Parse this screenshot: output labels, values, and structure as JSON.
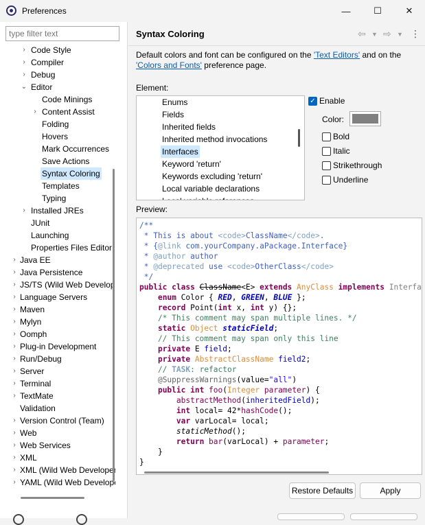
{
  "window": {
    "title": "Preferences",
    "minimize": "—",
    "maximize": "☐",
    "close": "✕"
  },
  "filter": {
    "placeholder": "type filter text"
  },
  "tree": [
    {
      "label": "Code Style",
      "twisty": "›",
      "indent": 1
    },
    {
      "label": "Compiler",
      "twisty": "›",
      "indent": 1
    },
    {
      "label": "Debug",
      "twisty": "›",
      "indent": 1
    },
    {
      "label": "Editor",
      "twisty": "⌄",
      "indent": 1
    },
    {
      "label": "Code Minings",
      "twisty": "",
      "indent": 2
    },
    {
      "label": "Content Assist",
      "twisty": "›",
      "indent": 2
    },
    {
      "label": "Folding",
      "twisty": "",
      "indent": 2
    },
    {
      "label": "Hovers",
      "twisty": "",
      "indent": 2
    },
    {
      "label": "Mark Occurrences",
      "twisty": "",
      "indent": 2
    },
    {
      "label": "Save Actions",
      "twisty": "",
      "indent": 2
    },
    {
      "label": "Syntax Coloring",
      "twisty": "",
      "indent": 2,
      "selected": true
    },
    {
      "label": "Templates",
      "twisty": "",
      "indent": 2
    },
    {
      "label": "Typing",
      "twisty": "",
      "indent": 2
    },
    {
      "label": "Installed JREs",
      "twisty": "›",
      "indent": 1
    },
    {
      "label": "JUnit",
      "twisty": "",
      "indent": 1
    },
    {
      "label": "Launching",
      "twisty": "",
      "indent": 1
    },
    {
      "label": "Properties Files Editor",
      "twisty": "",
      "indent": 1
    },
    {
      "label": "Java EE",
      "twisty": "›",
      "indent": 0
    },
    {
      "label": "Java Persistence",
      "twisty": "›",
      "indent": 0
    },
    {
      "label": "JS/TS (Wild Web Developer)",
      "twisty": "›",
      "indent": 0
    },
    {
      "label": "Language Servers",
      "twisty": "›",
      "indent": 0
    },
    {
      "label": "Maven",
      "twisty": "›",
      "indent": 0
    },
    {
      "label": "Mylyn",
      "twisty": "›",
      "indent": 0
    },
    {
      "label": "Oomph",
      "twisty": "›",
      "indent": 0
    },
    {
      "label": "Plug-in Development",
      "twisty": "›",
      "indent": 0
    },
    {
      "label": "Run/Debug",
      "twisty": "›",
      "indent": 0
    },
    {
      "label": "Server",
      "twisty": "›",
      "indent": 0
    },
    {
      "label": "Terminal",
      "twisty": "›",
      "indent": 0
    },
    {
      "label": "TextMate",
      "twisty": "›",
      "indent": 0
    },
    {
      "label": "Validation",
      "twisty": "",
      "indent": 0
    },
    {
      "label": "Version Control (Team)",
      "twisty": "›",
      "indent": 0
    },
    {
      "label": "Web",
      "twisty": "›",
      "indent": 0
    },
    {
      "label": "Web Services",
      "twisty": "›",
      "indent": 0
    },
    {
      "label": "XML",
      "twisty": "›",
      "indent": 0
    },
    {
      "label": "XML (Wild Web Developer)",
      "twisty": "›",
      "indent": 0
    },
    {
      "label": "YAML (Wild Web Developer)",
      "twisty": "›",
      "indent": 0
    }
  ],
  "page": {
    "title": "Syntax Coloring",
    "desc_before": "Default colors and font can be configured on the ",
    "link_text_editors": "'Text Editors'",
    "desc_middle": " and on the ",
    "link_colors_fonts": "'Colors and Fonts'",
    "desc_after": " preference page.",
    "element_label": "Element:",
    "preview_label": "Preview:"
  },
  "elements": [
    {
      "label": "Enums"
    },
    {
      "label": "Fields"
    },
    {
      "label": "Inherited fields"
    },
    {
      "label": "Inherited method invocations"
    },
    {
      "label": "Interfaces",
      "selected": true
    },
    {
      "label": "Keyword 'return'"
    },
    {
      "label": "Keywords excluding 'return'"
    },
    {
      "label": "Local variable declarations"
    },
    {
      "label": "Local variable references"
    }
  ],
  "options": {
    "enable": {
      "label": "Enable",
      "checked": true
    },
    "color_label": "Color:",
    "color_value": "#808080",
    "bold": {
      "label": "Bold",
      "checked": false
    },
    "italic": {
      "label": "Italic",
      "checked": false
    },
    "strikethrough": {
      "label": "Strikethrough",
      "checked": false
    },
    "underline": {
      "label": "Underline",
      "checked": false
    }
  },
  "colors": {
    "javadoc": "#3f5fbf",
    "tag": "#7f9fbf",
    "keyword": "#7f0055",
    "comment": "#3f7f5f",
    "interface": "#808080",
    "constant": "#0000c0",
    "field": "#0000c0",
    "string": "#2a00ff",
    "method": "#7f0055",
    "class": "#dc8c3c",
    "annotation": "#646464",
    "plain": "#000000",
    "task": "#7f9fbf",
    "selection": "#cde8ff",
    "link": "#0b5cad"
  },
  "code": [
    [
      [
        "/**",
        "javadoc"
      ]
    ],
    [
      [
        " * This is about ",
        "javadoc"
      ],
      [
        "<code>",
        "tag"
      ],
      [
        "ClassName",
        "javadoc"
      ],
      [
        "</code>",
        "tag"
      ],
      [
        ".",
        "javadoc"
      ]
    ],
    [
      [
        " * {",
        "javadoc"
      ],
      [
        "@link",
        "tag"
      ],
      [
        " com.yourCompany.aPackage.Interface}",
        "javadoc"
      ]
    ],
    [
      [
        " * ",
        "javadoc"
      ],
      [
        "@author",
        "tag"
      ],
      [
        " author",
        "javadoc"
      ]
    ],
    [
      [
        " * ",
        "javadoc"
      ],
      [
        "@deprecated",
        "tag"
      ],
      [
        " use ",
        "javadoc"
      ],
      [
        "<code>",
        "tag"
      ],
      [
        "OtherClass",
        "javadoc"
      ],
      [
        "</code>",
        "tag"
      ]
    ],
    [
      [
        " */",
        "javadoc"
      ]
    ],
    [
      [
        "public class ",
        "keyword"
      ],
      [
        "ClassName",
        "plain-strike"
      ],
      [
        "<E> ",
        "plain"
      ],
      [
        "extends ",
        "keyword"
      ],
      [
        "AnyClass ",
        "class"
      ],
      [
        "implements ",
        "keyword"
      ],
      [
        "InterfaceName",
        "interface"
      ]
    ],
    [
      [
        "    ",
        "plain"
      ],
      [
        "enum ",
        "keyword"
      ],
      [
        "Color { ",
        "plain"
      ],
      [
        "RED",
        "constant"
      ],
      [
        ", ",
        "plain"
      ],
      [
        "GREEN",
        "constant"
      ],
      [
        ", ",
        "plain"
      ],
      [
        "BLUE",
        "constant"
      ],
      [
        " };",
        "plain"
      ]
    ],
    [
      [
        "    ",
        "plain"
      ],
      [
        "record ",
        "keyword"
      ],
      [
        "Point(",
        "plain"
      ],
      [
        "int ",
        "keyword"
      ],
      [
        "x, ",
        "plain"
      ],
      [
        "int ",
        "keyword"
      ],
      [
        "y) {};",
        "plain"
      ]
    ],
    [
      [
        "    /* This comment may span multiple lines. */",
        "comment"
      ]
    ],
    [
      [
        "    ",
        "plain"
      ],
      [
        "static ",
        "keyword"
      ],
      [
        "Object ",
        "class"
      ],
      [
        "staticField",
        "field-italic"
      ],
      [
        ";",
        "plain"
      ]
    ],
    [
      [
        "    // This comment may span only this line",
        "comment"
      ]
    ],
    [
      [
        "    ",
        "plain"
      ],
      [
        "private ",
        "keyword"
      ],
      [
        "E ",
        "plain"
      ],
      [
        "field",
        "field"
      ],
      [
        ";",
        "plain"
      ]
    ],
    [
      [
        "    ",
        "plain"
      ],
      [
        "private ",
        "keyword"
      ],
      [
        "AbstractClassName ",
        "class"
      ],
      [
        "field2",
        "field"
      ],
      [
        ";",
        "plain"
      ]
    ],
    [
      [
        "    // ",
        "comment"
      ],
      [
        "TASK",
        "task-bold"
      ],
      [
        ": refactor",
        "comment"
      ]
    ],
    [
      [
        "    ",
        "plain"
      ],
      [
        "@SuppressWarnings",
        "annotation"
      ],
      [
        "(value=",
        "plain"
      ],
      [
        "\"all\"",
        "string"
      ],
      [
        ")",
        "plain"
      ]
    ],
    [
      [
        "    ",
        "plain"
      ],
      [
        "public int ",
        "keyword"
      ],
      [
        "foo",
        "method-plain"
      ],
      [
        "(",
        "plain"
      ],
      [
        "Integer ",
        "class"
      ],
      [
        "parameter",
        "method-plain"
      ],
      [
        ") {",
        "plain"
      ]
    ],
    [
      [
        "        ",
        "plain"
      ],
      [
        "abstractMethod",
        "method-plain"
      ],
      [
        "(",
        "plain"
      ],
      [
        "inheritedField",
        "field"
      ],
      [
        ");",
        "plain"
      ]
    ],
    [
      [
        "        ",
        "plain"
      ],
      [
        "int ",
        "keyword"
      ],
      [
        "local",
        "plain"
      ],
      [
        "= 42*",
        "plain"
      ],
      [
        "hashCode",
        "method-plain"
      ],
      [
        "();",
        "plain"
      ]
    ],
    [
      [
        "        ",
        "plain"
      ],
      [
        "var ",
        "keyword"
      ],
      [
        "varLocal",
        "plain"
      ],
      [
        "= local;",
        "plain"
      ]
    ],
    [
      [
        "        ",
        "plain"
      ],
      [
        "staticMethod",
        "italic"
      ],
      [
        "();",
        "plain"
      ]
    ],
    [
      [
        "        ",
        "plain"
      ],
      [
        "return ",
        "keyword"
      ],
      [
        "bar",
        "method-plain"
      ],
      [
        "(varLocal) + ",
        "plain"
      ],
      [
        "parameter",
        "method-plain"
      ],
      [
        ";",
        "plain"
      ]
    ],
    [
      [
        "    }",
        "plain"
      ]
    ],
    [
      [
        "}",
        "plain"
      ]
    ]
  ],
  "buttons": {
    "restore": "Restore Defaults",
    "apply": "Apply"
  }
}
